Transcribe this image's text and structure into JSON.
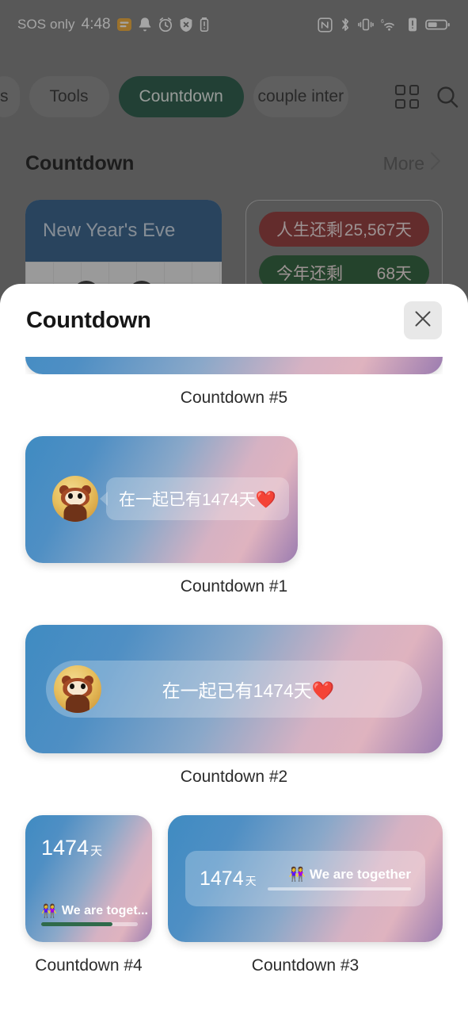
{
  "status_bar": {
    "carrier": "SOS only",
    "time": "4:48",
    "left_icons": [
      "notes-icon",
      "bell-icon",
      "alarm-icon",
      "shield-off-icon",
      "battery-saver-icon"
    ],
    "right_icons": [
      "nfc-icon",
      "bluetooth-icon",
      "vibrate-icon",
      "wifi-6-icon",
      "alert-icon",
      "battery-icon"
    ]
  },
  "tab_bar": {
    "tabs": [
      {
        "label": "s",
        "active": false
      },
      {
        "label": "Tools",
        "active": false
      },
      {
        "label": "Countdown",
        "active": true
      },
      {
        "label": "couple inter",
        "active": false
      }
    ],
    "grid_icon": "grid-view-icon",
    "search_icon": "search-icon"
  },
  "section": {
    "title": "Countdown",
    "more_label": "More",
    "chevron": "chevron-right-icon"
  },
  "background_widgets": {
    "new_year_card": {
      "title": "New Year's Eve"
    },
    "remaining_card": {
      "rows": [
        {
          "label": "人生还剩",
          "value": "25,567天",
          "color": "#8d3030"
        },
        {
          "label": "今年还剩",
          "value": "68天",
          "color": "#22572f"
        }
      ]
    }
  },
  "modal": {
    "title": "Countdown",
    "close_icon": "close-icon",
    "widgets": [
      {
        "id": "card-5",
        "label": "Countdown #5",
        "kind": "partial-top"
      },
      {
        "id": "card-1",
        "label": "Countdown #1",
        "kind": "bubble",
        "avatar": "pet-avatar-icon",
        "message": "在一起已有1474天",
        "heart": "❤️"
      },
      {
        "id": "card-2",
        "label": "Countdown #2",
        "kind": "wide-pill",
        "avatar": "pet-avatar-icon",
        "message": "在一起已有1474天",
        "heart": "❤️"
      },
      {
        "id": "card-4",
        "label": "Countdown #4",
        "kind": "small-progress",
        "days_number": "1474",
        "days_unit": "天",
        "couple_emoji": "👭",
        "caption": "We are toget...",
        "progress_percent": 74
      },
      {
        "id": "card-3",
        "label": "Countdown #3",
        "kind": "wide-progress",
        "days_number": "1474",
        "days_unit": "天",
        "couple_emoji": "👭",
        "caption": "We are together",
        "progress_percent": 100
      }
    ]
  },
  "colors": {
    "accent_green": "#1e513f",
    "gradient_start": "#3f8bc2",
    "gradient_mid": "#d6b2c3",
    "gradient_end": "#9b7cb0",
    "sheet_bg": "#ffffff",
    "scrim": "rgba(40,40,40,0.42)"
  }
}
